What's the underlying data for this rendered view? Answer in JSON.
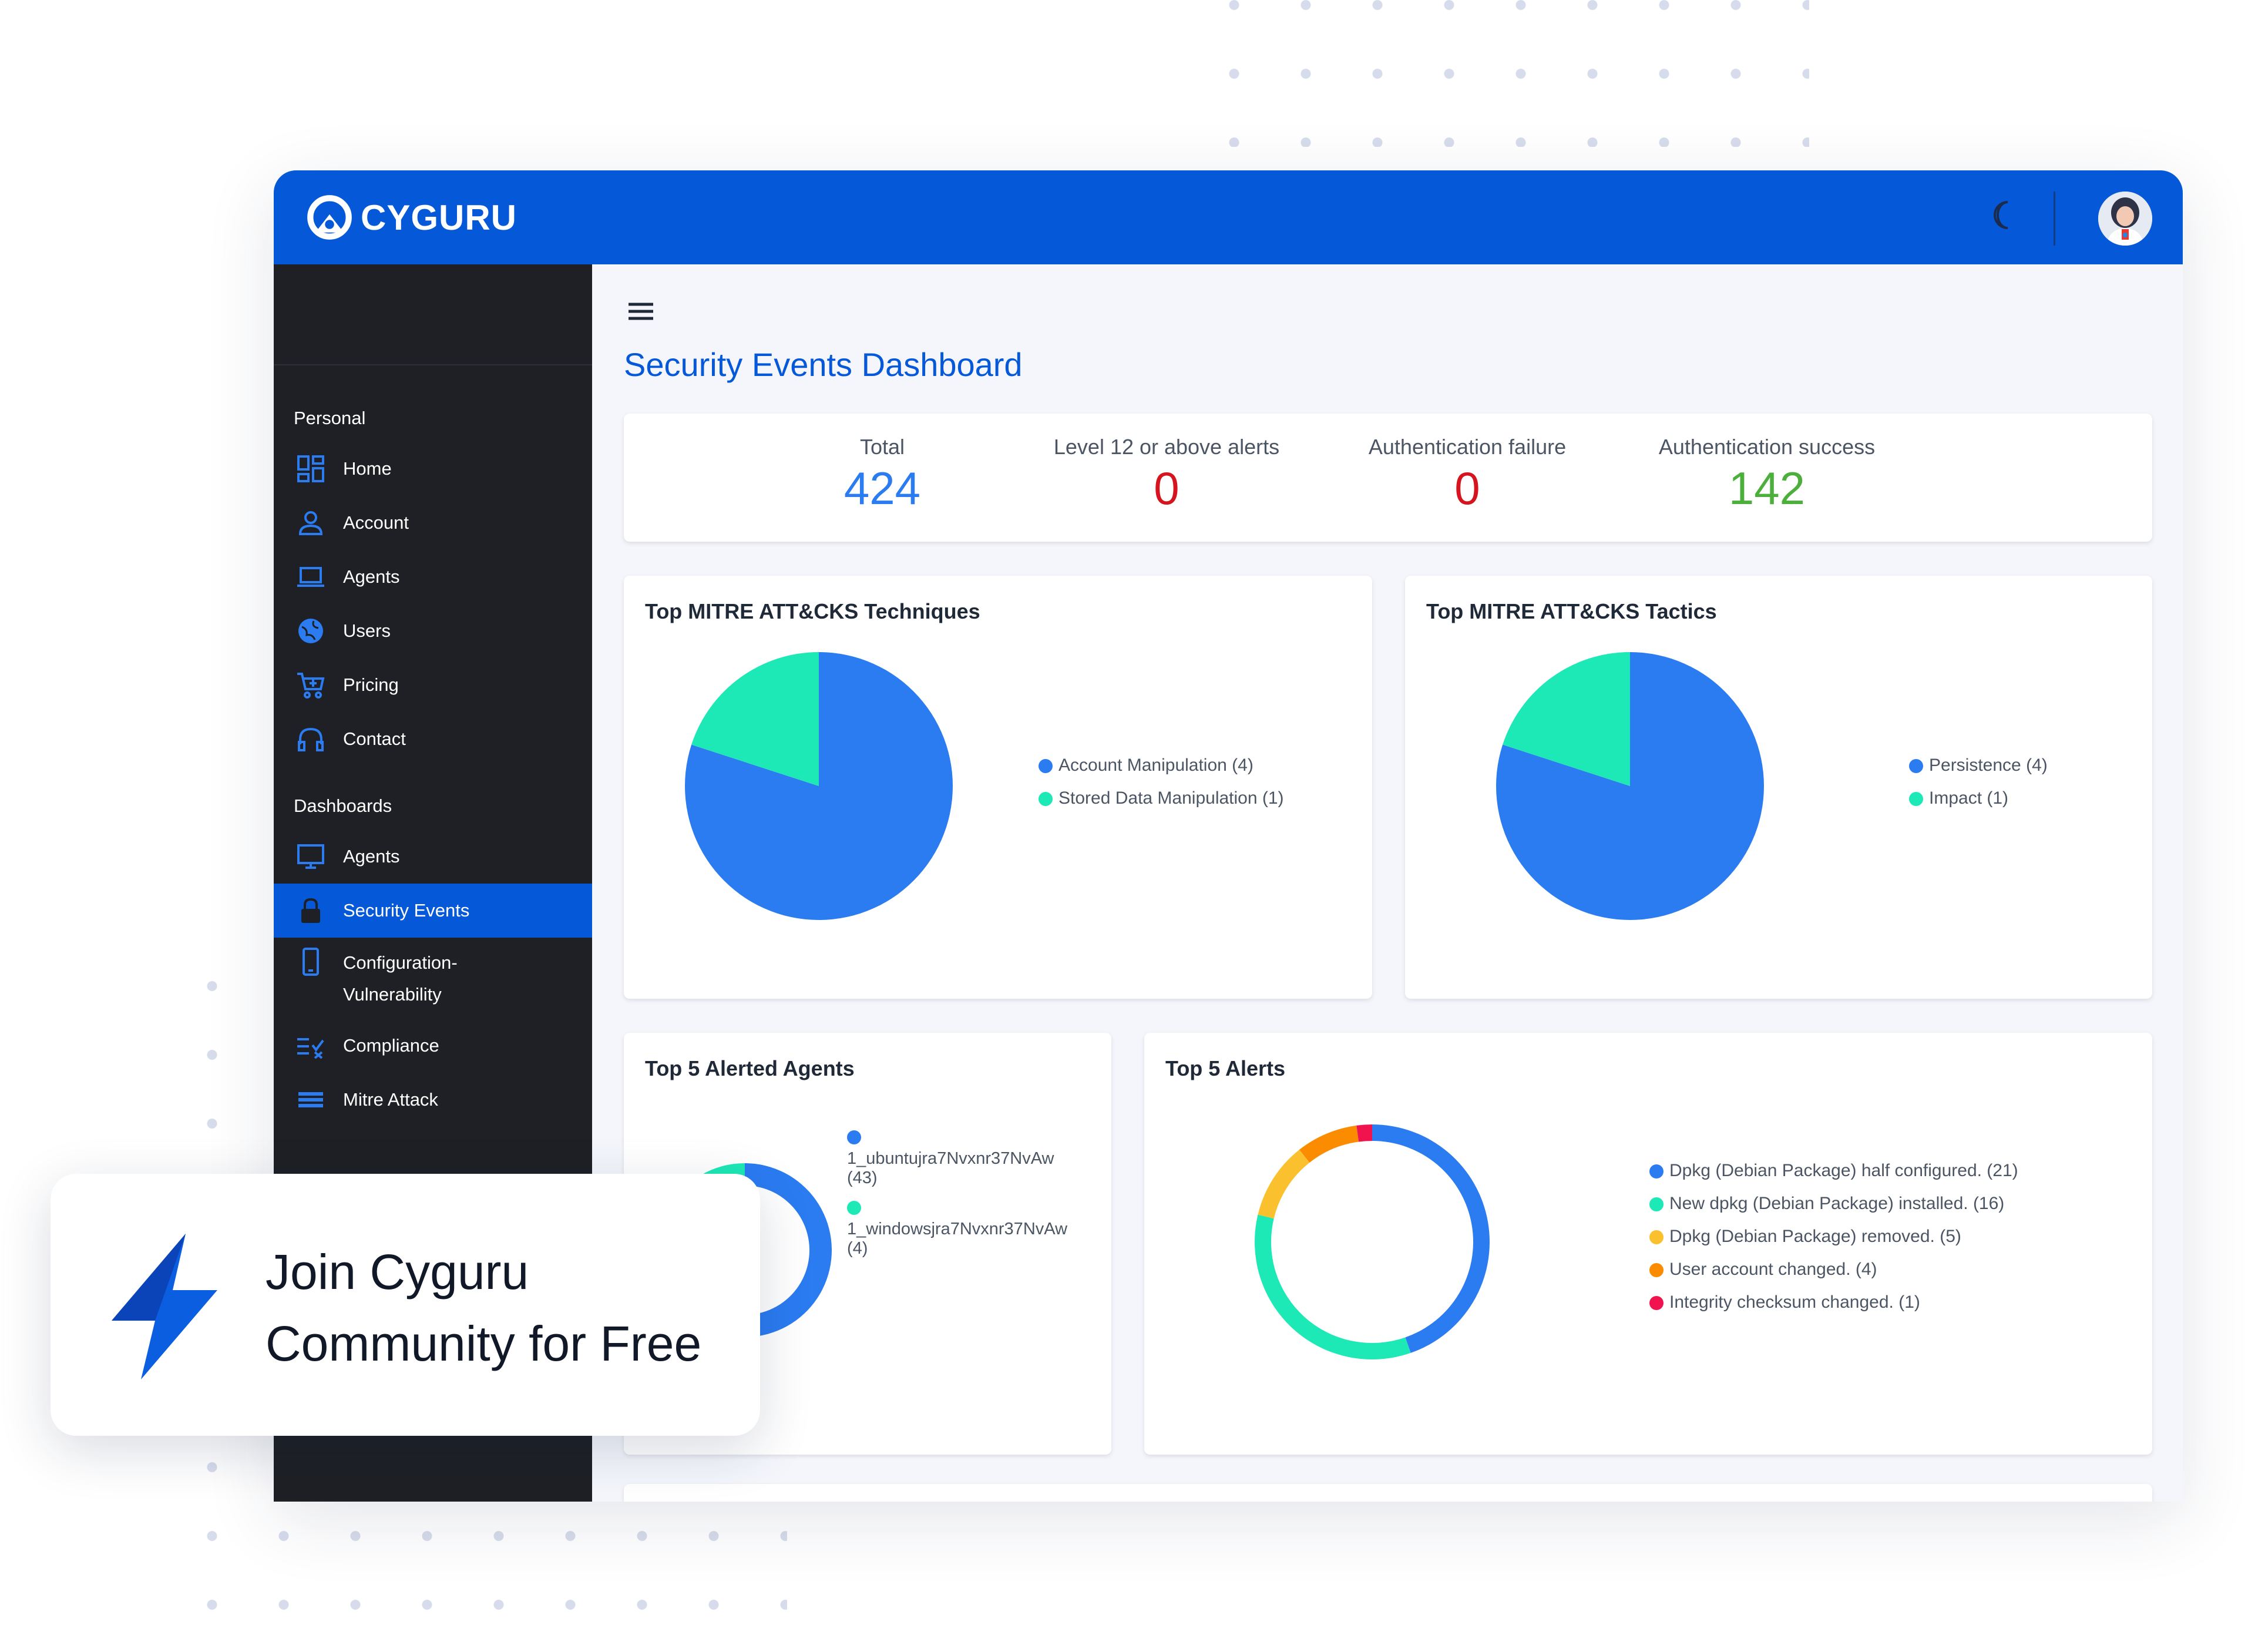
{
  "app": {
    "brand": "CYGURU",
    "accent": "#0559d8",
    "sidebar_bg": "#1e2025",
    "icons": {
      "theme_toggle": "moon-icon",
      "menu": "hamburger-icon",
      "user": "avatar"
    }
  },
  "sidebar": {
    "personal_label": "Personal",
    "personal_items": [
      {
        "label": "Home",
        "icon": "dashboard-grid-icon"
      },
      {
        "label": "Account",
        "icon": "user-icon"
      },
      {
        "label": "Agents",
        "icon": "laptop-icon"
      },
      {
        "label": "Users",
        "icon": "globe-icon"
      },
      {
        "label": "Pricing",
        "icon": "cart-icon"
      },
      {
        "label": "Contact",
        "icon": "headphones-icon"
      }
    ],
    "dashboards_label": "Dashboards",
    "dashboard_items": [
      {
        "label": "Agents",
        "icon": "monitor-icon"
      },
      {
        "label": "Security Events",
        "icon": "lock-icon",
        "active": true
      },
      {
        "label": "Configuration-",
        "label2": "Vulnerability",
        "icon": "phone-icon"
      },
      {
        "label": "Compliance",
        "icon": "checklist-icon"
      },
      {
        "label": "Mitre Attack",
        "icon": "stack-icon"
      }
    ]
  },
  "main": {
    "title": "Security Events Dashboard",
    "stats": [
      {
        "label": "Total",
        "value": "424",
        "color": "#2b7bf1"
      },
      {
        "label": "Level 12 or above alerts",
        "value": "0",
        "color": "#d6141e"
      },
      {
        "label": "Authentication failure",
        "value": "0",
        "color": "#d6141e"
      },
      {
        "label": "Authentication success",
        "value": "142",
        "color": "#4caf3c"
      }
    ]
  },
  "chart_data": [
    {
      "type": "pie",
      "title": "Top MITRE ATT&CKS Techniques",
      "categories": [
        "Account Manipulation (4)",
        "Stored Data Manipulation (1)"
      ],
      "values": [
        4,
        1
      ],
      "colors": [
        "#2b7bf1",
        "#1de9b6"
      ],
      "legend": "right"
    },
    {
      "type": "pie",
      "title": "Top MITRE ATT&CKS Tactics",
      "categories": [
        "Persistence (4)",
        "Impact (1)"
      ],
      "values": [
        4,
        1
      ],
      "colors": [
        "#2b7bf1",
        "#1de9b6"
      ],
      "legend": "right"
    },
    {
      "type": "pie",
      "title": "Top 5 Alerted Agents",
      "categories": [
        "1_ubuntujra7Nvxnr37NvAw",
        "1_windowsjra7Nvxnr37NvAw"
      ],
      "counts": [
        "(43)",
        "(4)"
      ],
      "values": [
        43,
        4
      ],
      "colors": [
        "#2b7bf1",
        "#1de9b6"
      ],
      "legend": "right"
    },
    {
      "type": "pie",
      "title": "Top 5 Alerts",
      "categories": [
        "Dpkg (Debian Package) half configured. (21)",
        "New dpkg (Debian Package) installed. (16)",
        "Dpkg (Debian Package) removed. (5)",
        "User account changed. (4)",
        "Integrity checksum changed. (1)"
      ],
      "values": [
        21,
        16,
        5,
        4,
        1
      ],
      "colors": [
        "#2b7bf1",
        "#1de9b6",
        "#fbc02d",
        "#fb8c00",
        "#f0134d"
      ],
      "legend": "right"
    }
  ],
  "promo": {
    "line1": "Join Cyguru",
    "line2": "Community for Free",
    "icon": "lightning-bolt-icon"
  }
}
